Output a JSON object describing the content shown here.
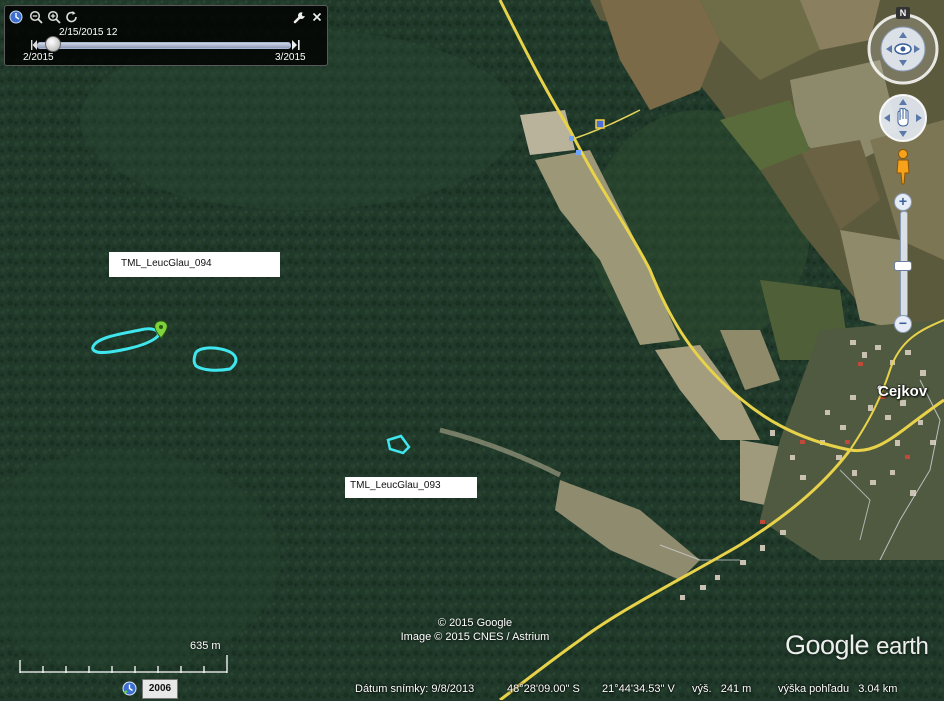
{
  "time_slider": {
    "current_label": "2/15/2015  12",
    "start_label": "2/2015",
    "end_label": "3/2015",
    "position": 0.06
  },
  "toolbar_icons": [
    "clock-icon",
    "zoom-out-icon",
    "zoom-in-icon",
    "refresh-icon",
    "wrench-icon",
    "close-icon"
  ],
  "placemarks": [
    {
      "label": "TML_LeucGlau_094"
    },
    {
      "label": "TML_LeucGlau_093"
    }
  ],
  "place_names": {
    "town": "Cejkov"
  },
  "navigation": {
    "compass_north": "N",
    "zoom_in": "+",
    "zoom_out": "−",
    "zoom_level": 0.48
  },
  "scale": {
    "label": "635 m"
  },
  "credits": {
    "line1": "© 2015 Google",
    "line2": "Image © 2015 CNES / Astrium"
  },
  "logo": {
    "main": "Google",
    "sub": "earth"
  },
  "status": {
    "historical_year": "2006",
    "imagery_date": "Dátum snímky: 9/8/2013",
    "latitude": "48°28'09.00\" S",
    "longitude": "21°44'34.53\" V",
    "elevation": "výš.   241 m",
    "eye_altitude": "výška pohľadu   3.04 km"
  },
  "colors": {
    "forest": "#1f3a2a",
    "road": "#e8d24a",
    "polygon": "#3fe6ee",
    "placemark": "#7ed23c"
  }
}
